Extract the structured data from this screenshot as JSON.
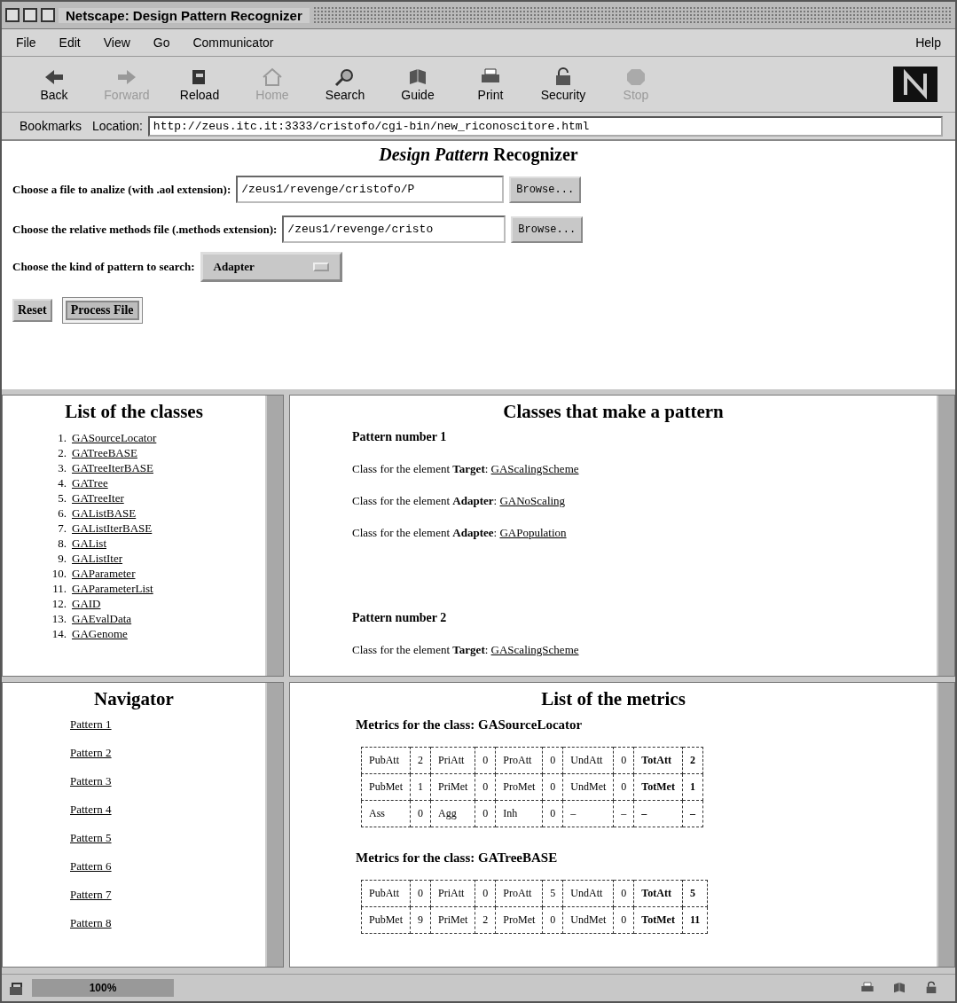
{
  "window": {
    "title": "Netscape: Design Pattern Recognizer"
  },
  "menu": {
    "items": [
      "File",
      "Edit",
      "View",
      "Go",
      "Communicator"
    ],
    "help": "Help"
  },
  "toolbar": [
    {
      "label": "Back",
      "disabled": false
    },
    {
      "label": "Forward",
      "disabled": true
    },
    {
      "label": "Reload",
      "disabled": false
    },
    {
      "label": "Home",
      "disabled": true
    },
    {
      "label": "Search",
      "disabled": false
    },
    {
      "label": "Guide",
      "disabled": false
    },
    {
      "label": "Print",
      "disabled": false
    },
    {
      "label": "Security",
      "disabled": false
    },
    {
      "label": "Stop",
      "disabled": true
    }
  ],
  "location_bar": {
    "bookmarks": "Bookmarks",
    "label": "Location:",
    "url": "http://zeus.itc.it:3333/cristofo/cgi-bin/new_riconoscitore.html"
  },
  "form": {
    "heading": "*Design Pattern* Recognizer",
    "fields": [
      {
        "label": "Choose a file to analize (with .aol extension):",
        "value": "/zeus1/revenge/cristofo/P",
        "button": "Browse..."
      },
      {
        "label": "Choose the relative methods file (.methods extension):",
        "value": "/zeus1/revenge/cristo",
        "button": "Browse..."
      }
    ],
    "pattern": {
      "label": "Choose the kind of pattern to search:",
      "value": "Adapter"
    },
    "buttons": [
      {
        "label": "Reset",
        "default": false
      },
      {
        "label": "Process File",
        "default": true
      }
    ]
  },
  "classes_frame": {
    "title": "List of the classes",
    "items": [
      {
        "number": "1.",
        "name": "GASourceLocator"
      },
      {
        "number": "2.",
        "name": "GATreeBASE"
      },
      {
        "number": "3.",
        "name": "GATreeIterBASE"
      },
      {
        "number": "4.",
        "name": "GATree"
      },
      {
        "number": "5.",
        "name": "GATreeIter"
      },
      {
        "number": "6.",
        "name": "GAListBASE"
      },
      {
        "number": "7.",
        "name": "GAListIterBASE"
      },
      {
        "number": "8.",
        "name": "GAList"
      },
      {
        "number": "9.",
        "name": "GAListIter"
      },
      {
        "number": "10.",
        "name": "GAParameter"
      },
      {
        "number": "11.",
        "name": "GAParameterList"
      },
      {
        "number": "12.",
        "name": "GAID"
      },
      {
        "number": "13.",
        "name": "GAEvalData"
      },
      {
        "number": "14.",
        "name": "GAGenome"
      }
    ]
  },
  "patterns_frame": {
    "title": "Classes that make a pattern",
    "patterns": [
      {
        "heading": "Pattern number 1",
        "elements": [
          {
            "text": "Class for the element **Target**:",
            "link": "GAScalingScheme"
          },
          {
            "text": "Class for the element **Adapter**:",
            "link": "GANoScaling"
          },
          {
            "text": "Class for the element **Adaptee**:",
            "link": "GAPopulation"
          }
        ]
      },
      {
        "heading": "Pattern number 2",
        "elements": [
          {
            "text": "Class for the element **Target**:",
            "link": "GAScalingScheme"
          }
        ]
      }
    ]
  },
  "navigator_frame": {
    "title": "Navigator",
    "links": [
      "Pattern 1",
      "Pattern 2",
      "Pattern 3",
      "Pattern 4",
      "Pattern 5",
      "Pattern 6",
      "Pattern 7",
      "Pattern 8"
    ]
  },
  "metrics_frame": {
    "title": "List of the metrics",
    "classes": [
      {
        "heading": "Metrics for the class: GASourceLocator",
        "rows": [
          [
            "PubAtt",
            "2",
            "PriAtt",
            "0",
            "ProAtt",
            "0",
            "UndAtt",
            "0",
            "TotAtt",
            "2"
          ],
          [
            "PubMet",
            "1",
            "PriMet",
            "0",
            "ProMet",
            "0",
            "UndMet",
            "0",
            "TotMet",
            "1"
          ],
          [
            "Ass",
            "0",
            "Agg",
            "0",
            "Inh",
            "0",
            "–",
            "–",
            "–",
            "–"
          ]
        ]
      },
      {
        "heading": "Metrics for the class: GATreeBASE",
        "rows": [
          [
            "PubAtt",
            "0",
            "PriAtt",
            "0",
            "ProAtt",
            "5",
            "UndAtt",
            "0",
            "TotAtt",
            "5"
          ],
          [
            "PubMet",
            "9",
            "PriMet",
            "2",
            "ProMet",
            "0",
            "UndMet",
            "0",
            "TotMet",
            "11"
          ]
        ]
      }
    ]
  },
  "status_bar": {
    "progress": "100%"
  }
}
